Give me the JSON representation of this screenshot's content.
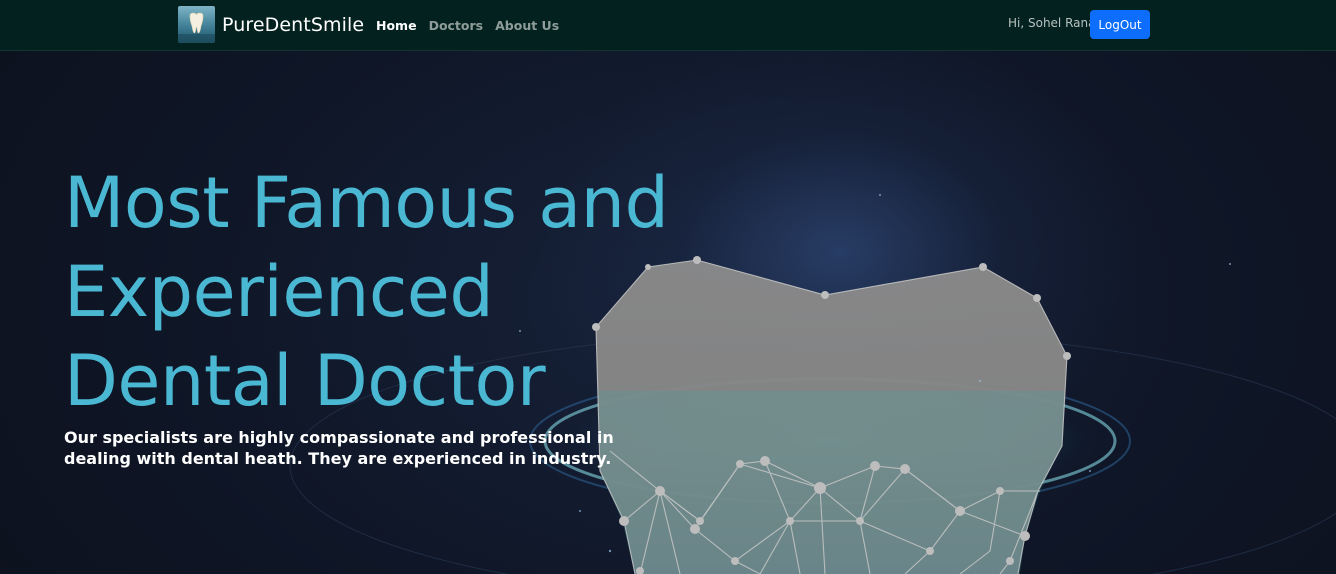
{
  "navbar": {
    "brand": "PureDentSmile",
    "links": [
      {
        "label": "Home",
        "active": true
      },
      {
        "label": "Doctors",
        "active": false
      },
      {
        "label": "About Us",
        "active": false
      }
    ],
    "greeting": "Hi, Sohel Rana",
    "logout_label": "LogOut"
  },
  "hero": {
    "title_line1": "Most Famous and",
    "title_line2": "Experienced",
    "title_line3": "Dental Doctor",
    "subtitle": "Our specialists are highly compassionate and professional in dealing with dental heath. They are experienced in industry."
  },
  "colors": {
    "navbar_bg": "#03211f",
    "accent_title": "#4bb8d3",
    "logout_button": "#0d6efd",
    "hero_bg": "#0f1627"
  }
}
